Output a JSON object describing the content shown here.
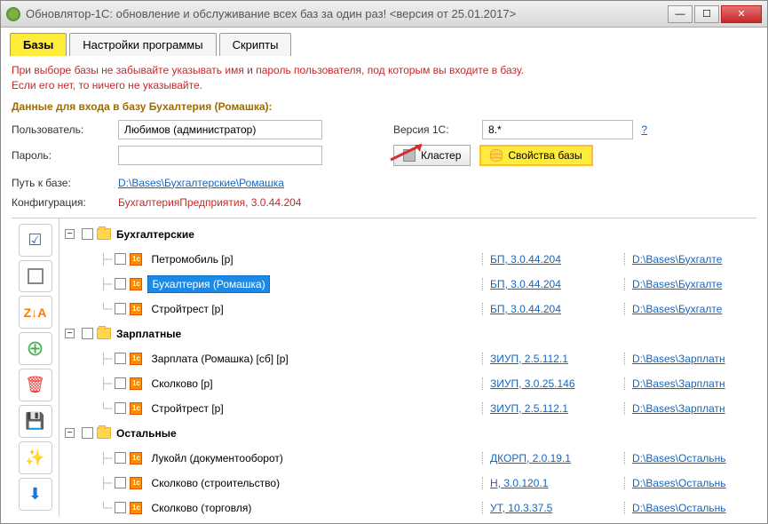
{
  "title": "Обновлятор-1С: обновление и обслуживание всех баз за один раз! <версия от 25.01.2017>",
  "tabs": {
    "t0": "Базы",
    "t1": "Настройки программы",
    "t2": "Скрипты"
  },
  "warn": "При выборе базы не забывайте указывать имя и пароль пользователя, под которым вы входите в базу.\nЕсли его нет, то ничего не указывайте.",
  "section": "Данные для входа в базу Бухалтерия (Ромашка):",
  "labels": {
    "user": "Пользователь:",
    "pass": "Пароль:",
    "ver": "Версия 1С:",
    "path": "Путь к базе:",
    "config": "Конфигурация:"
  },
  "values": {
    "user": "Любимов (администратор)",
    "ver": "8.*",
    "path": "D:\\Bases\\Бухгалтерские\\Ромашка",
    "config": "БухгалтерияПредприятия, 3.0.44.204"
  },
  "buttons": {
    "cluster": "Кластер",
    "props": "Свойства базы"
  },
  "tree": {
    "g0": {
      "label": "Бухгалтерские"
    },
    "g0_i0": {
      "label": "Петромобиль [р]",
      "ver": "БП, 3.0.44.204",
      "path": "D:\\Bases\\Бухгалте"
    },
    "g0_i1": {
      "label": "Бухалтерия (Ромашка)",
      "ver": "БП, 3.0.44.204",
      "path": "D:\\Bases\\Бухгалте"
    },
    "g0_i2": {
      "label": "Стройтрест [р]",
      "ver": "БП, 3.0.44.204",
      "path": "D:\\Bases\\Бухгалте"
    },
    "g1": {
      "label": "Зарплатные"
    },
    "g1_i0": {
      "label": "Зарплата (Ромашка) [сб] [р]",
      "ver": "ЗИУП, 2.5.112.1",
      "path": "D:\\Bases\\Зарплатн"
    },
    "g1_i1": {
      "label": "Сколково [р]",
      "ver": "ЗИУП, 3.0.25.146",
      "path": "D:\\Bases\\Зарплатн"
    },
    "g1_i2": {
      "label": "Стройтрест [р]",
      "ver": "ЗИУП, 2.5.112.1",
      "path": "D:\\Bases\\Зарплатн"
    },
    "g2": {
      "label": "Остальные"
    },
    "g2_i0": {
      "label": "Лукойл (документооборот)",
      "ver": "ДКОРП, 2.0.19.1",
      "path": "D:\\Bases\\Остальнь"
    },
    "g2_i1": {
      "label": "Сколково (строительство)",
      "ver": "Н, 3.0.120.1",
      "path": "D:\\Bases\\Остальнь"
    },
    "g2_i2": {
      "label": "Сколково (торговля)",
      "ver": "УТ, 10.3.37.5",
      "path": "D:\\Bases\\Остальнь"
    }
  },
  "sidebar": {
    "za": "Z↓A"
  }
}
